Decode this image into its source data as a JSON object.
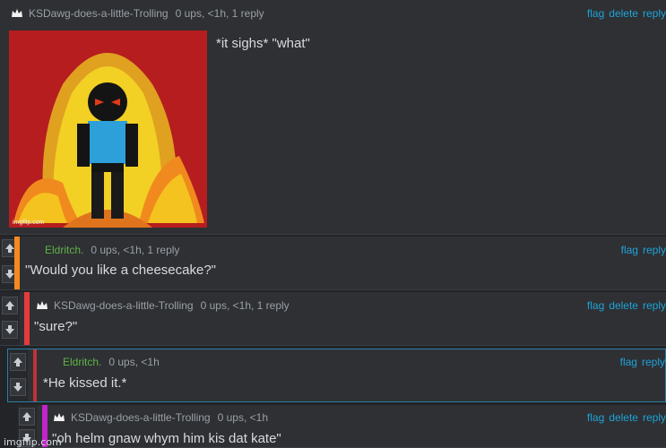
{
  "thread": [
    {
      "user": "KSDawg-does-a-little-Trolling",
      "meta": "0 ups, <1h, 1 reply",
      "actions": [
        "flag",
        "delete",
        "reply"
      ],
      "text": "*it sighs* \"what\"",
      "has_image": true
    },
    {
      "user": "Eldritch.",
      "meta": "0 ups, <1h, 1 reply",
      "actions": [
        "flag",
        "reply"
      ],
      "text": "\"Would you like a cheesecake?\"",
      "bar_color": "#f5891f"
    },
    {
      "user": "KSDawg-does-a-little-Trolling",
      "meta": "0 ups, <1h, 1 reply",
      "actions": [
        "flag",
        "delete",
        "reply"
      ],
      "text": "\"sure?\"",
      "bar_color": "#e53b3b"
    },
    {
      "user": "Eldritch.",
      "meta": "0 ups, <1h",
      "actions": [
        "flag",
        "reply"
      ],
      "text": "*He kissed it.*",
      "bar_color": "#c0303a"
    },
    {
      "user": "KSDawg-does-a-little-Trolling",
      "meta": "0 ups, <1h",
      "actions": [
        "flag",
        "delete",
        "reply"
      ],
      "text": "\"oh helm gnaw whym him kis dat kate\"",
      "bar_color": "#c125c9"
    }
  ],
  "watermark": "imgflip.com",
  "colors": {
    "link": "#1fa3d8",
    "username_green": "#5fb347",
    "background": "#2e3033"
  }
}
